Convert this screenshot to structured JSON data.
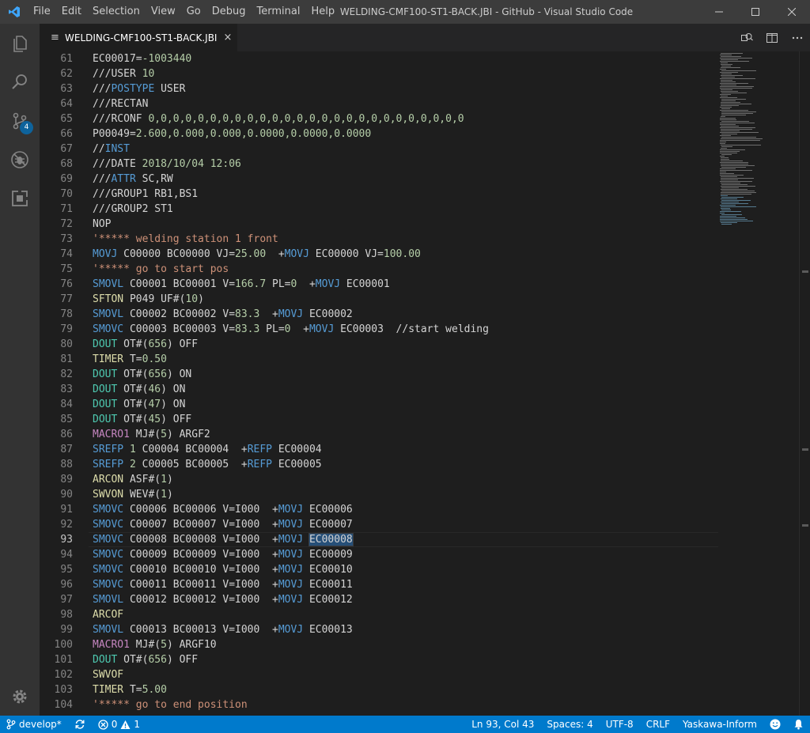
{
  "window": {
    "title": "WELDING-CMF100-ST1-BACK.JBI - GitHub - Visual Studio Code"
  },
  "menu": [
    "File",
    "Edit",
    "Selection",
    "View",
    "Go",
    "Debug",
    "Terminal",
    "Help"
  ],
  "activity": {
    "scm_badge": "4"
  },
  "tab": {
    "label": "WELDING-CMF100-ST1-BACK.JBI",
    "icon": "≡",
    "close": "×"
  },
  "editor": {
    "current_line": 93,
    "highlight_token": "EC00008",
    "lines": [
      {
        "n": "61",
        "t": [
          [
            "EC00017=",
            "plain"
          ],
          [
            "-1003440",
            "green"
          ]
        ]
      },
      {
        "n": "62",
        "t": [
          [
            "///USER ",
            "plain"
          ],
          [
            "10",
            "green"
          ]
        ]
      },
      {
        "n": "63",
        "t": [
          [
            "///",
            "plain"
          ],
          [
            "POSTYPE",
            "blue"
          ],
          [
            " USER",
            "plain"
          ]
        ]
      },
      {
        "n": "64",
        "t": [
          [
            "///RECTAN",
            "plain"
          ]
        ]
      },
      {
        "n": "65",
        "t": [
          [
            "///RCONF ",
            "plain"
          ],
          [
            "0,0,0,0,0,0,0,0,0,0,0,0,0,0,0,0,0,0,0,0,0,0,0,0,0,0",
            "green"
          ]
        ]
      },
      {
        "n": "66",
        "t": [
          [
            "P00049=",
            "plain"
          ],
          [
            "2.600,0.000,0.000,0.0000,0.0000,0.0000",
            "green"
          ]
        ]
      },
      {
        "n": "67",
        "t": [
          [
            "//",
            "plain"
          ],
          [
            "INST",
            "blue"
          ]
        ]
      },
      {
        "n": "68",
        "t": [
          [
            "///DATE ",
            "plain"
          ],
          [
            "2018/10/04 12:06",
            "green"
          ]
        ]
      },
      {
        "n": "69",
        "t": [
          [
            "///",
            "plain"
          ],
          [
            "ATTR",
            "blue"
          ],
          [
            " SC,RW",
            "plain"
          ]
        ]
      },
      {
        "n": "70",
        "t": [
          [
            "///GROUP1 RB1,BS1",
            "plain"
          ]
        ]
      },
      {
        "n": "71",
        "t": [
          [
            "///GROUP2 ST1",
            "plain"
          ]
        ]
      },
      {
        "n": "72",
        "t": [
          [
            "NOP",
            "plain"
          ]
        ]
      },
      {
        "n": "73",
        "t": [
          [
            "'***** welding station 1 front",
            "orange"
          ]
        ]
      },
      {
        "n": "74",
        "t": [
          [
            "MOVJ",
            "blue"
          ],
          [
            " C00000 BC00000 VJ=",
            "plain"
          ],
          [
            "25.00",
            "green"
          ],
          [
            "  +",
            "plain"
          ],
          [
            "MOVJ",
            "blue"
          ],
          [
            " EC00000 VJ=",
            "plain"
          ],
          [
            "100.00",
            "green"
          ]
        ]
      },
      {
        "n": "75",
        "t": [
          [
            "'***** go to start pos",
            "orange"
          ]
        ]
      },
      {
        "n": "76",
        "t": [
          [
            "SMOVL",
            "blue"
          ],
          [
            " C00001 BC00001 V=",
            "plain"
          ],
          [
            "166.7",
            "green"
          ],
          [
            " PL=",
            "plain"
          ],
          [
            "0",
            "green"
          ],
          [
            "  +",
            "plain"
          ],
          [
            "MOVJ",
            "blue"
          ],
          [
            " EC00001",
            "plain"
          ]
        ]
      },
      {
        "n": "77",
        "t": [
          [
            "SFTON",
            "yellow"
          ],
          [
            " P049 UF#(",
            "plain"
          ],
          [
            "10",
            "green"
          ],
          [
            ")",
            "plain"
          ]
        ]
      },
      {
        "n": "78",
        "t": [
          [
            "SMOVL",
            "blue"
          ],
          [
            " C00002 BC00002 V=",
            "plain"
          ],
          [
            "83.3",
            "green"
          ],
          [
            "  +",
            "plain"
          ],
          [
            "MOVJ",
            "blue"
          ],
          [
            " EC00002",
            "plain"
          ]
        ]
      },
      {
        "n": "79",
        "t": [
          [
            "SMOVC",
            "blue"
          ],
          [
            " C00003 BC00003 V=",
            "plain"
          ],
          [
            "83.3",
            "green"
          ],
          [
            " PL=",
            "plain"
          ],
          [
            "0",
            "green"
          ],
          [
            "  +",
            "plain"
          ],
          [
            "MOVJ",
            "blue"
          ],
          [
            " EC00003  //start welding",
            "plain"
          ]
        ]
      },
      {
        "n": "80",
        "t": [
          [
            "DOUT",
            "teal"
          ],
          [
            " OT#(",
            "plain"
          ],
          [
            "656",
            "green"
          ],
          [
            ") OFF",
            "plain"
          ]
        ]
      },
      {
        "n": "81",
        "t": [
          [
            "TIMER",
            "yellow"
          ],
          [
            " T=",
            "plain"
          ],
          [
            "0.50",
            "green"
          ]
        ]
      },
      {
        "n": "82",
        "t": [
          [
            "DOUT",
            "teal"
          ],
          [
            " OT#(",
            "plain"
          ],
          [
            "656",
            "green"
          ],
          [
            ") ON",
            "plain"
          ]
        ]
      },
      {
        "n": "83",
        "t": [
          [
            "DOUT",
            "teal"
          ],
          [
            " OT#(",
            "plain"
          ],
          [
            "46",
            "green"
          ],
          [
            ") ON",
            "plain"
          ]
        ]
      },
      {
        "n": "84",
        "t": [
          [
            "DOUT",
            "teal"
          ],
          [
            " OT#(",
            "plain"
          ],
          [
            "47",
            "green"
          ],
          [
            ") ON",
            "plain"
          ]
        ]
      },
      {
        "n": "85",
        "t": [
          [
            "DOUT",
            "teal"
          ],
          [
            " OT#(",
            "plain"
          ],
          [
            "45",
            "green"
          ],
          [
            ") OFF",
            "plain"
          ]
        ]
      },
      {
        "n": "86",
        "t": [
          [
            "MACRO1",
            "purple"
          ],
          [
            " MJ#(",
            "plain"
          ],
          [
            "5",
            "green"
          ],
          [
            ") ARGF2",
            "plain"
          ]
        ]
      },
      {
        "n": "87",
        "t": [
          [
            "SREFP",
            "blue"
          ],
          [
            " ",
            "plain"
          ],
          [
            "1",
            "green"
          ],
          [
            " C00004 BC00004  +",
            "plain"
          ],
          [
            "REFP",
            "blue"
          ],
          [
            " EC00004",
            "plain"
          ]
        ]
      },
      {
        "n": "88",
        "t": [
          [
            "SREFP",
            "blue"
          ],
          [
            " ",
            "plain"
          ],
          [
            "2",
            "green"
          ],
          [
            " C00005 BC00005  +",
            "plain"
          ],
          [
            "REFP",
            "blue"
          ],
          [
            " EC00005",
            "plain"
          ]
        ]
      },
      {
        "n": "89",
        "t": [
          [
            "ARCON",
            "yellow"
          ],
          [
            " ASF#(",
            "plain"
          ],
          [
            "1",
            "green"
          ],
          [
            ")",
            "plain"
          ]
        ]
      },
      {
        "n": "90",
        "t": [
          [
            "SWVON",
            "yellow"
          ],
          [
            " WEV#(",
            "plain"
          ],
          [
            "1",
            "green"
          ],
          [
            ")",
            "plain"
          ]
        ]
      },
      {
        "n": "91",
        "t": [
          [
            "SMOVC",
            "blue"
          ],
          [
            " C00006 BC00006 V=I000  +",
            "plain"
          ],
          [
            "MOVJ",
            "blue"
          ],
          [
            " EC00006",
            "plain"
          ]
        ]
      },
      {
        "n": "92",
        "t": [
          [
            "SMOVC",
            "blue"
          ],
          [
            " C00007 BC00007 V=I000  +",
            "plain"
          ],
          [
            "MOVJ",
            "blue"
          ],
          [
            " EC00007",
            "plain"
          ]
        ]
      },
      {
        "n": "93",
        "t": [
          [
            "SMOVC",
            "blue"
          ],
          [
            " C00008 BC00008 V=I000  +",
            "plain"
          ],
          [
            "MOVJ",
            "blue"
          ],
          [
            " ",
            "plain"
          ],
          [
            "EC00008",
            "hl"
          ]
        ]
      },
      {
        "n": "94",
        "t": [
          [
            "SMOVC",
            "blue"
          ],
          [
            " C00009 BC00009 V=I000  +",
            "plain"
          ],
          [
            "MOVJ",
            "blue"
          ],
          [
            " EC00009",
            "plain"
          ]
        ]
      },
      {
        "n": "95",
        "t": [
          [
            "SMOVC",
            "blue"
          ],
          [
            " C00010 BC00010 V=I000  +",
            "plain"
          ],
          [
            "MOVJ",
            "blue"
          ],
          [
            " EC00010",
            "plain"
          ]
        ]
      },
      {
        "n": "96",
        "t": [
          [
            "SMOVC",
            "blue"
          ],
          [
            " C00011 BC00011 V=I000  +",
            "plain"
          ],
          [
            "MOVJ",
            "blue"
          ],
          [
            " EC00011",
            "plain"
          ]
        ]
      },
      {
        "n": "97",
        "t": [
          [
            "SMOVL",
            "blue"
          ],
          [
            " C00012 BC00012 V=I000  +",
            "plain"
          ],
          [
            "MOVJ",
            "blue"
          ],
          [
            " EC00012",
            "plain"
          ]
        ]
      },
      {
        "n": "98",
        "t": [
          [
            "ARCOF",
            "yellow"
          ]
        ]
      },
      {
        "n": "99",
        "t": [
          [
            "SMOVL",
            "blue"
          ],
          [
            " C00013 BC00013 V=I000  +",
            "plain"
          ],
          [
            "MOVJ",
            "blue"
          ],
          [
            " EC00013",
            "plain"
          ]
        ]
      },
      {
        "n": "100",
        "t": [
          [
            "MACRO1",
            "purple"
          ],
          [
            " MJ#(",
            "plain"
          ],
          [
            "5",
            "green"
          ],
          [
            ") ARGF10",
            "plain"
          ]
        ]
      },
      {
        "n": "101",
        "t": [
          [
            "DOUT",
            "teal"
          ],
          [
            " OT#(",
            "plain"
          ],
          [
            "656",
            "green"
          ],
          [
            ") OFF",
            "plain"
          ]
        ]
      },
      {
        "n": "102",
        "t": [
          [
            "SWVOF",
            "yellow"
          ]
        ]
      },
      {
        "n": "103",
        "t": [
          [
            "TIMER",
            "yellow"
          ],
          [
            " T=",
            "plain"
          ],
          [
            "5.00",
            "green"
          ]
        ]
      },
      {
        "n": "104",
        "t": [
          [
            "'***** go to end position",
            "orange"
          ]
        ]
      }
    ]
  },
  "statusbar": {
    "branch": "develop*",
    "errors": "0",
    "warnings": "1",
    "position": "Ln 93, Col 43",
    "spaces": "Spaces: 4",
    "encoding": "UTF-8",
    "eol": "CRLF",
    "language": "Yaskawa-Inform"
  },
  "colors": {
    "titlebar": "#3c3c3c",
    "activitybar": "#333333",
    "editor_bg": "#1e1e1e",
    "statusbar": "#007acc",
    "accent": "#0e639c"
  }
}
